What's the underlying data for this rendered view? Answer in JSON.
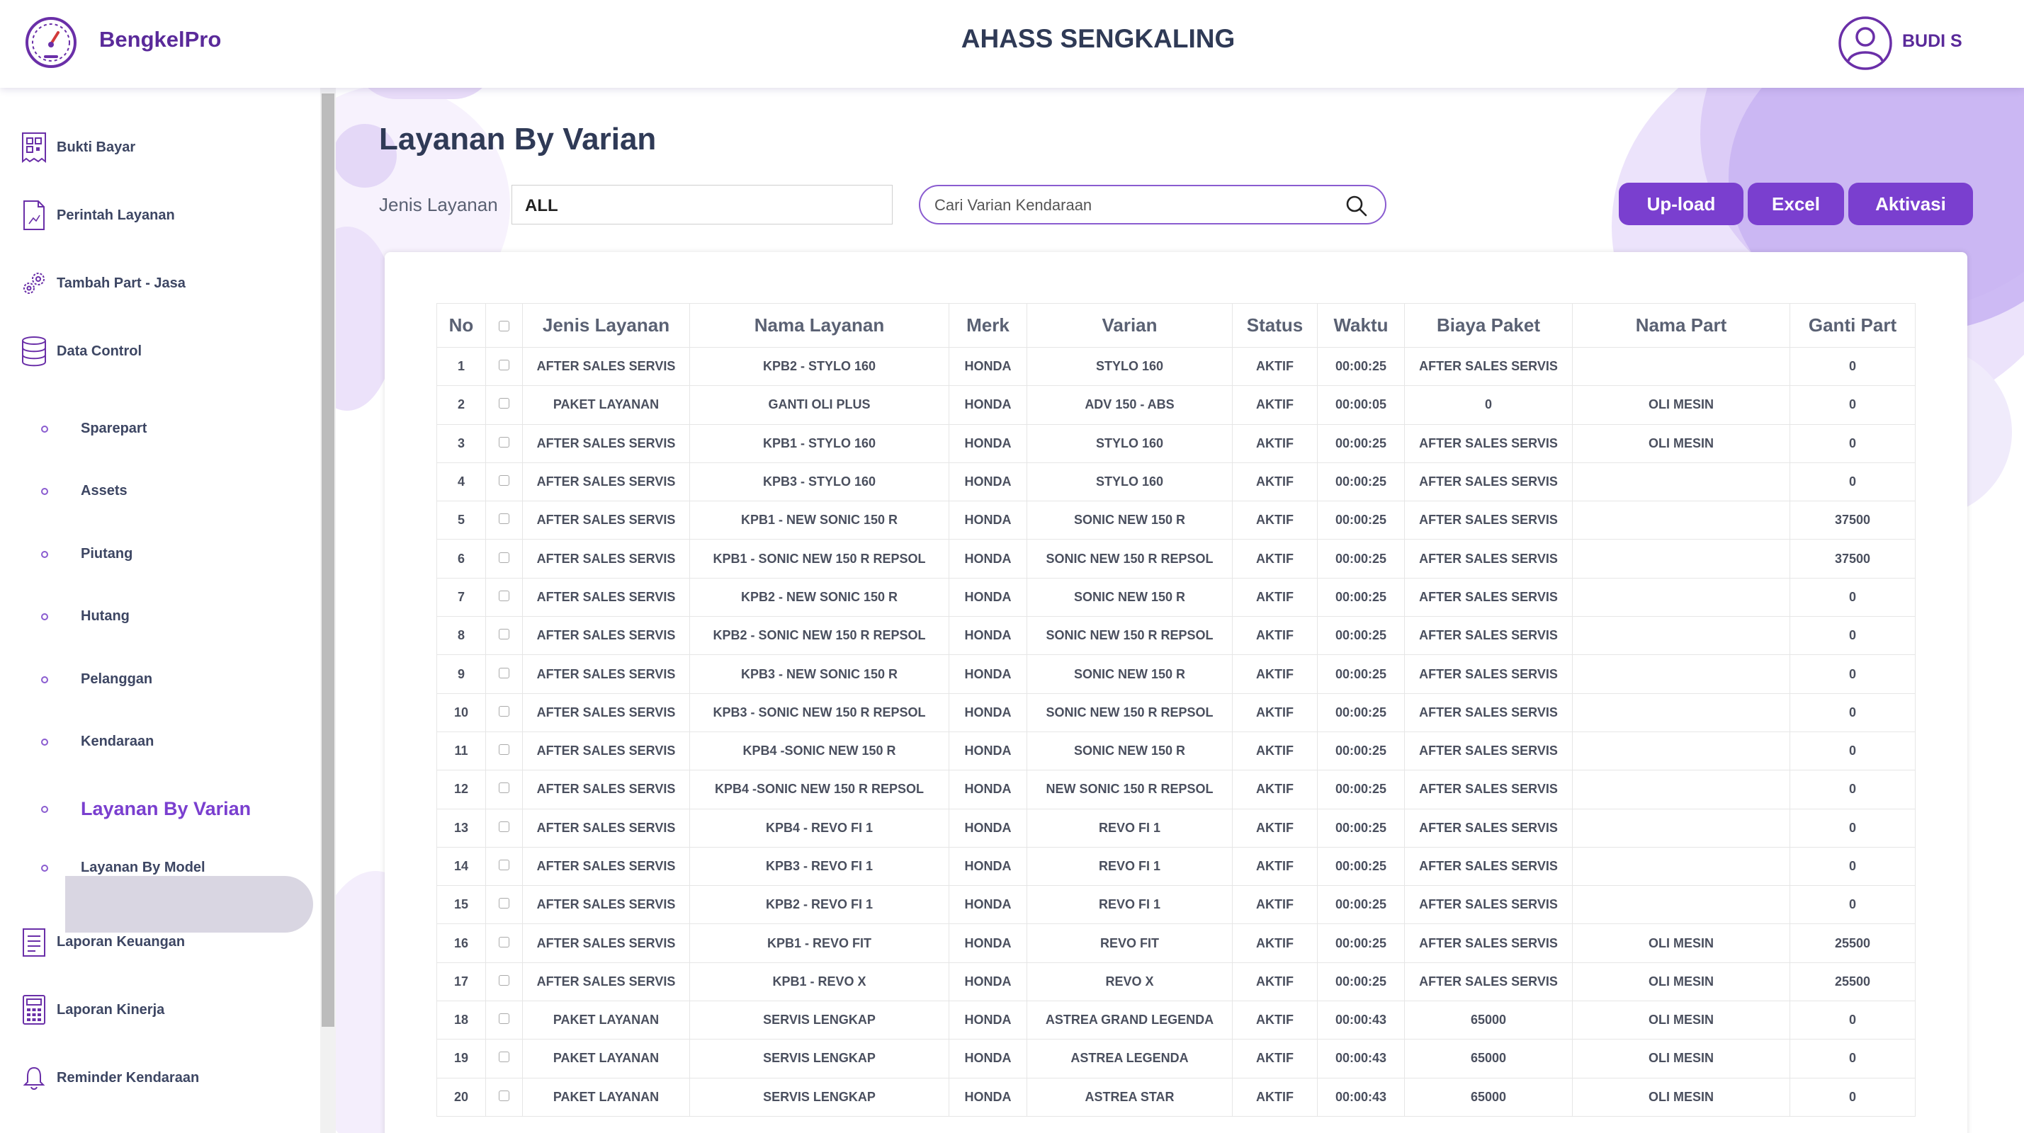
{
  "header": {
    "brand": "BengkelPro",
    "branch": "AHASS SENGKALING",
    "user": "BUDI S"
  },
  "sidebar": {
    "items": [
      {
        "label": "Bukti Bayar",
        "icon": "receipt-qr-icon"
      },
      {
        "label": "Perintah Layanan",
        "icon": "document-icon"
      },
      {
        "label": "Tambah Part - Jasa",
        "icon": "gears-icon"
      },
      {
        "label": "Data Control",
        "icon": "database-icon"
      }
    ],
    "sub_items": [
      {
        "label": "Sparepart"
      },
      {
        "label": "Assets"
      },
      {
        "label": "Piutang"
      },
      {
        "label": "Hutang"
      },
      {
        "label": "Pelanggan"
      },
      {
        "label": "Kendaraan"
      },
      {
        "label": "Layanan By Varian"
      },
      {
        "label": "Layanan By Model"
      }
    ],
    "active_sub": "Layanan By Varian",
    "bottom_items": [
      {
        "label": "Laporan Keuangan",
        "icon": "report-list-icon"
      },
      {
        "label": "Laporan Kinerja",
        "icon": "calculator-icon"
      },
      {
        "label": "Reminder Kendaraan",
        "icon": "bell-icon"
      }
    ]
  },
  "main": {
    "title": "Layanan By Varian",
    "filter_label": "Jenis Layanan",
    "filter_value": "ALL",
    "search_placeholder": "Cari Varian Kendaraan",
    "buttons": {
      "upload": "Up-load",
      "excel": "Excel",
      "aktivasi": "Aktivasi"
    }
  },
  "table": {
    "headers": [
      "No",
      "",
      "Jenis Layanan",
      "Nama Layanan",
      "Merk",
      "Varian",
      "Status",
      "Waktu",
      "Biaya Paket",
      "Nama Part",
      "Ganti Part"
    ],
    "rows": [
      [
        "1",
        "AFTER SALES SERVIS",
        "KPB2 - STYLO 160",
        "HONDA",
        "STYLO 160",
        "AKTIF",
        "00:00:25",
        "AFTER SALES SERVIS",
        "",
        "0"
      ],
      [
        "2",
        "PAKET LAYANAN",
        "GANTI OLI PLUS",
        "HONDA",
        "ADV 150 - ABS",
        "AKTIF",
        "00:00:05",
        "0",
        "OLI MESIN",
        "0"
      ],
      [
        "3",
        "AFTER SALES SERVIS",
        "KPB1 - STYLO 160",
        "HONDA",
        "STYLO 160",
        "AKTIF",
        "00:00:25",
        "AFTER SALES SERVIS",
        "OLI MESIN",
        "0"
      ],
      [
        "4",
        "AFTER SALES SERVIS",
        "KPB3 - STYLO 160",
        "HONDA",
        "STYLO 160",
        "AKTIF",
        "00:00:25",
        "AFTER SALES SERVIS",
        "",
        "0"
      ],
      [
        "5",
        "AFTER SALES SERVIS",
        "KPB1 - NEW SONIC 150 R",
        "HONDA",
        "SONIC NEW 150 R",
        "AKTIF",
        "00:00:25",
        "AFTER SALES SERVIS",
        "",
        "37500"
      ],
      [
        "6",
        "AFTER SALES SERVIS",
        "KPB1 - SONIC NEW 150 R REPSOL",
        "HONDA",
        "SONIC NEW 150 R REPSOL",
        "AKTIF",
        "00:00:25",
        "AFTER SALES SERVIS",
        "",
        "37500"
      ],
      [
        "7",
        "AFTER SALES SERVIS",
        "KPB2 - NEW SONIC 150 R",
        "HONDA",
        "SONIC NEW 150 R",
        "AKTIF",
        "00:00:25",
        "AFTER SALES SERVIS",
        "",
        "0"
      ],
      [
        "8",
        "AFTER SALES SERVIS",
        "KPB2 - SONIC NEW 150 R REPSOL",
        "HONDA",
        "SONIC NEW 150 R REPSOL",
        "AKTIF",
        "00:00:25",
        "AFTER SALES SERVIS",
        "",
        "0"
      ],
      [
        "9",
        "AFTER SALES SERVIS",
        "KPB3 - NEW SONIC 150 R",
        "HONDA",
        "SONIC NEW 150 R",
        "AKTIF",
        "00:00:25",
        "AFTER SALES SERVIS",
        "",
        "0"
      ],
      [
        "10",
        "AFTER SALES SERVIS",
        "KPB3 - SONIC NEW 150 R REPSOL",
        "HONDA",
        "SONIC NEW 150 R REPSOL",
        "AKTIF",
        "00:00:25",
        "AFTER SALES SERVIS",
        "",
        "0"
      ],
      [
        "11",
        "AFTER SALES SERVIS",
        "KPB4 -SONIC NEW 150 R",
        "HONDA",
        "SONIC NEW 150 R",
        "AKTIF",
        "00:00:25",
        "AFTER SALES SERVIS",
        "",
        "0"
      ],
      [
        "12",
        "AFTER SALES SERVIS",
        "KPB4 -SONIC NEW 150 R REPSOL",
        "HONDA",
        "NEW SONIC 150 R REPSOL",
        "AKTIF",
        "00:00:25",
        "AFTER SALES SERVIS",
        "",
        "0"
      ],
      [
        "13",
        "AFTER SALES SERVIS",
        "KPB4 - REVO FI 1",
        "HONDA",
        "REVO FI 1",
        "AKTIF",
        "00:00:25",
        "AFTER SALES SERVIS",
        "",
        "0"
      ],
      [
        "14",
        "AFTER SALES SERVIS",
        "KPB3 - REVO FI 1",
        "HONDA",
        "REVO FI 1",
        "AKTIF",
        "00:00:25",
        "AFTER SALES SERVIS",
        "",
        "0"
      ],
      [
        "15",
        "AFTER SALES SERVIS",
        "KPB2 - REVO FI 1",
        "HONDA",
        "REVO FI 1",
        "AKTIF",
        "00:00:25",
        "AFTER SALES SERVIS",
        "",
        "0"
      ],
      [
        "16",
        "AFTER SALES SERVIS",
        "KPB1 - REVO FIT",
        "HONDA",
        "REVO FIT",
        "AKTIF",
        "00:00:25",
        "AFTER SALES SERVIS",
        "OLI MESIN",
        "25500"
      ],
      [
        "17",
        "AFTER SALES SERVIS",
        "KPB1 - REVO X",
        "HONDA",
        "REVO X",
        "AKTIF",
        "00:00:25",
        "AFTER SALES SERVIS",
        "OLI MESIN",
        "25500"
      ],
      [
        "18",
        "PAKET LAYANAN",
        "SERVIS LENGKAP",
        "HONDA",
        "ASTREA GRAND LEGENDA",
        "AKTIF",
        "00:00:43",
        "65000",
        "OLI MESIN",
        "0"
      ],
      [
        "19",
        "PAKET LAYANAN",
        "SERVIS LENGKAP",
        "HONDA",
        "ASTREA LEGENDA",
        "AKTIF",
        "00:00:43",
        "65000",
        "OLI MESIN",
        "0"
      ],
      [
        "20",
        "PAKET LAYANAN",
        "SERVIS LENGKAP",
        "HONDA",
        "ASTREA STAR",
        "AKTIF",
        "00:00:43",
        "65000",
        "OLI MESIN",
        "0"
      ]
    ]
  },
  "colors": {
    "accent": "#7a3fcf",
    "title": "#2f3a56",
    "brand": "#5a2a9a"
  }
}
